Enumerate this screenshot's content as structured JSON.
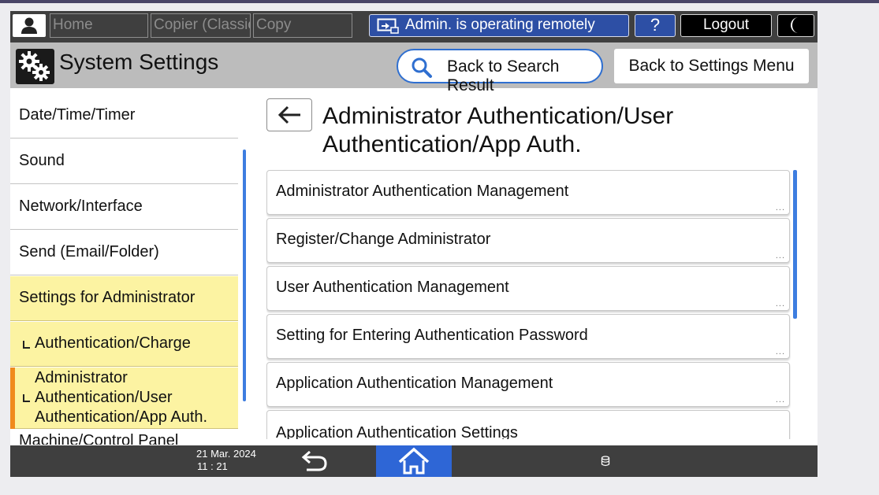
{
  "status_bar": {
    "home": "Home",
    "copier_classic": "Copier (Classic)",
    "copy": "Copy",
    "admin_status": "Admin. is operating remotely",
    "help": "?",
    "logout": "Logout"
  },
  "header": {
    "title": "System Settings",
    "back_search": "Back to Search Result",
    "back_settings": "Back to Settings Menu"
  },
  "nav": {
    "items": [
      "Date/Time/Timer",
      "Sound",
      "Network/Interface",
      "Send (Email/Folder)",
      "Settings for Administrator"
    ],
    "sub_item": "Authentication/Charge",
    "active_lines": [
      "Administrator",
      "Authentication/User",
      "Authentication/App Auth."
    ],
    "partial": "Machine/Control Panel"
  },
  "content": {
    "title_line1": "Administrator Authentication/User",
    "title_line2": "Authentication/App Auth.",
    "rows": [
      "Administrator Authentication Management",
      "Register/Change Administrator",
      "User Authentication Management",
      "Setting for Entering Authentication Password",
      "Application Authentication Management",
      "Application Authentication Settings"
    ],
    "ellipsis": "..."
  },
  "bottom_bar": {
    "date": "21 Mar. 2024",
    "time": "11 : 21"
  },
  "colors": {
    "accent_blue": "#2d4fa5",
    "home_blue": "#2e66d6",
    "selected_yellow": "#fcf3a2",
    "active_orange": "#f08a1c",
    "bar_dark": "#3f3f3f"
  },
  "icons": [
    "user-icon",
    "remote-admin-icon",
    "moon-icon",
    "gears-icon",
    "search-icon",
    "back-arrow-icon",
    "undo-icon",
    "home-icon",
    "storage-icon"
  ]
}
